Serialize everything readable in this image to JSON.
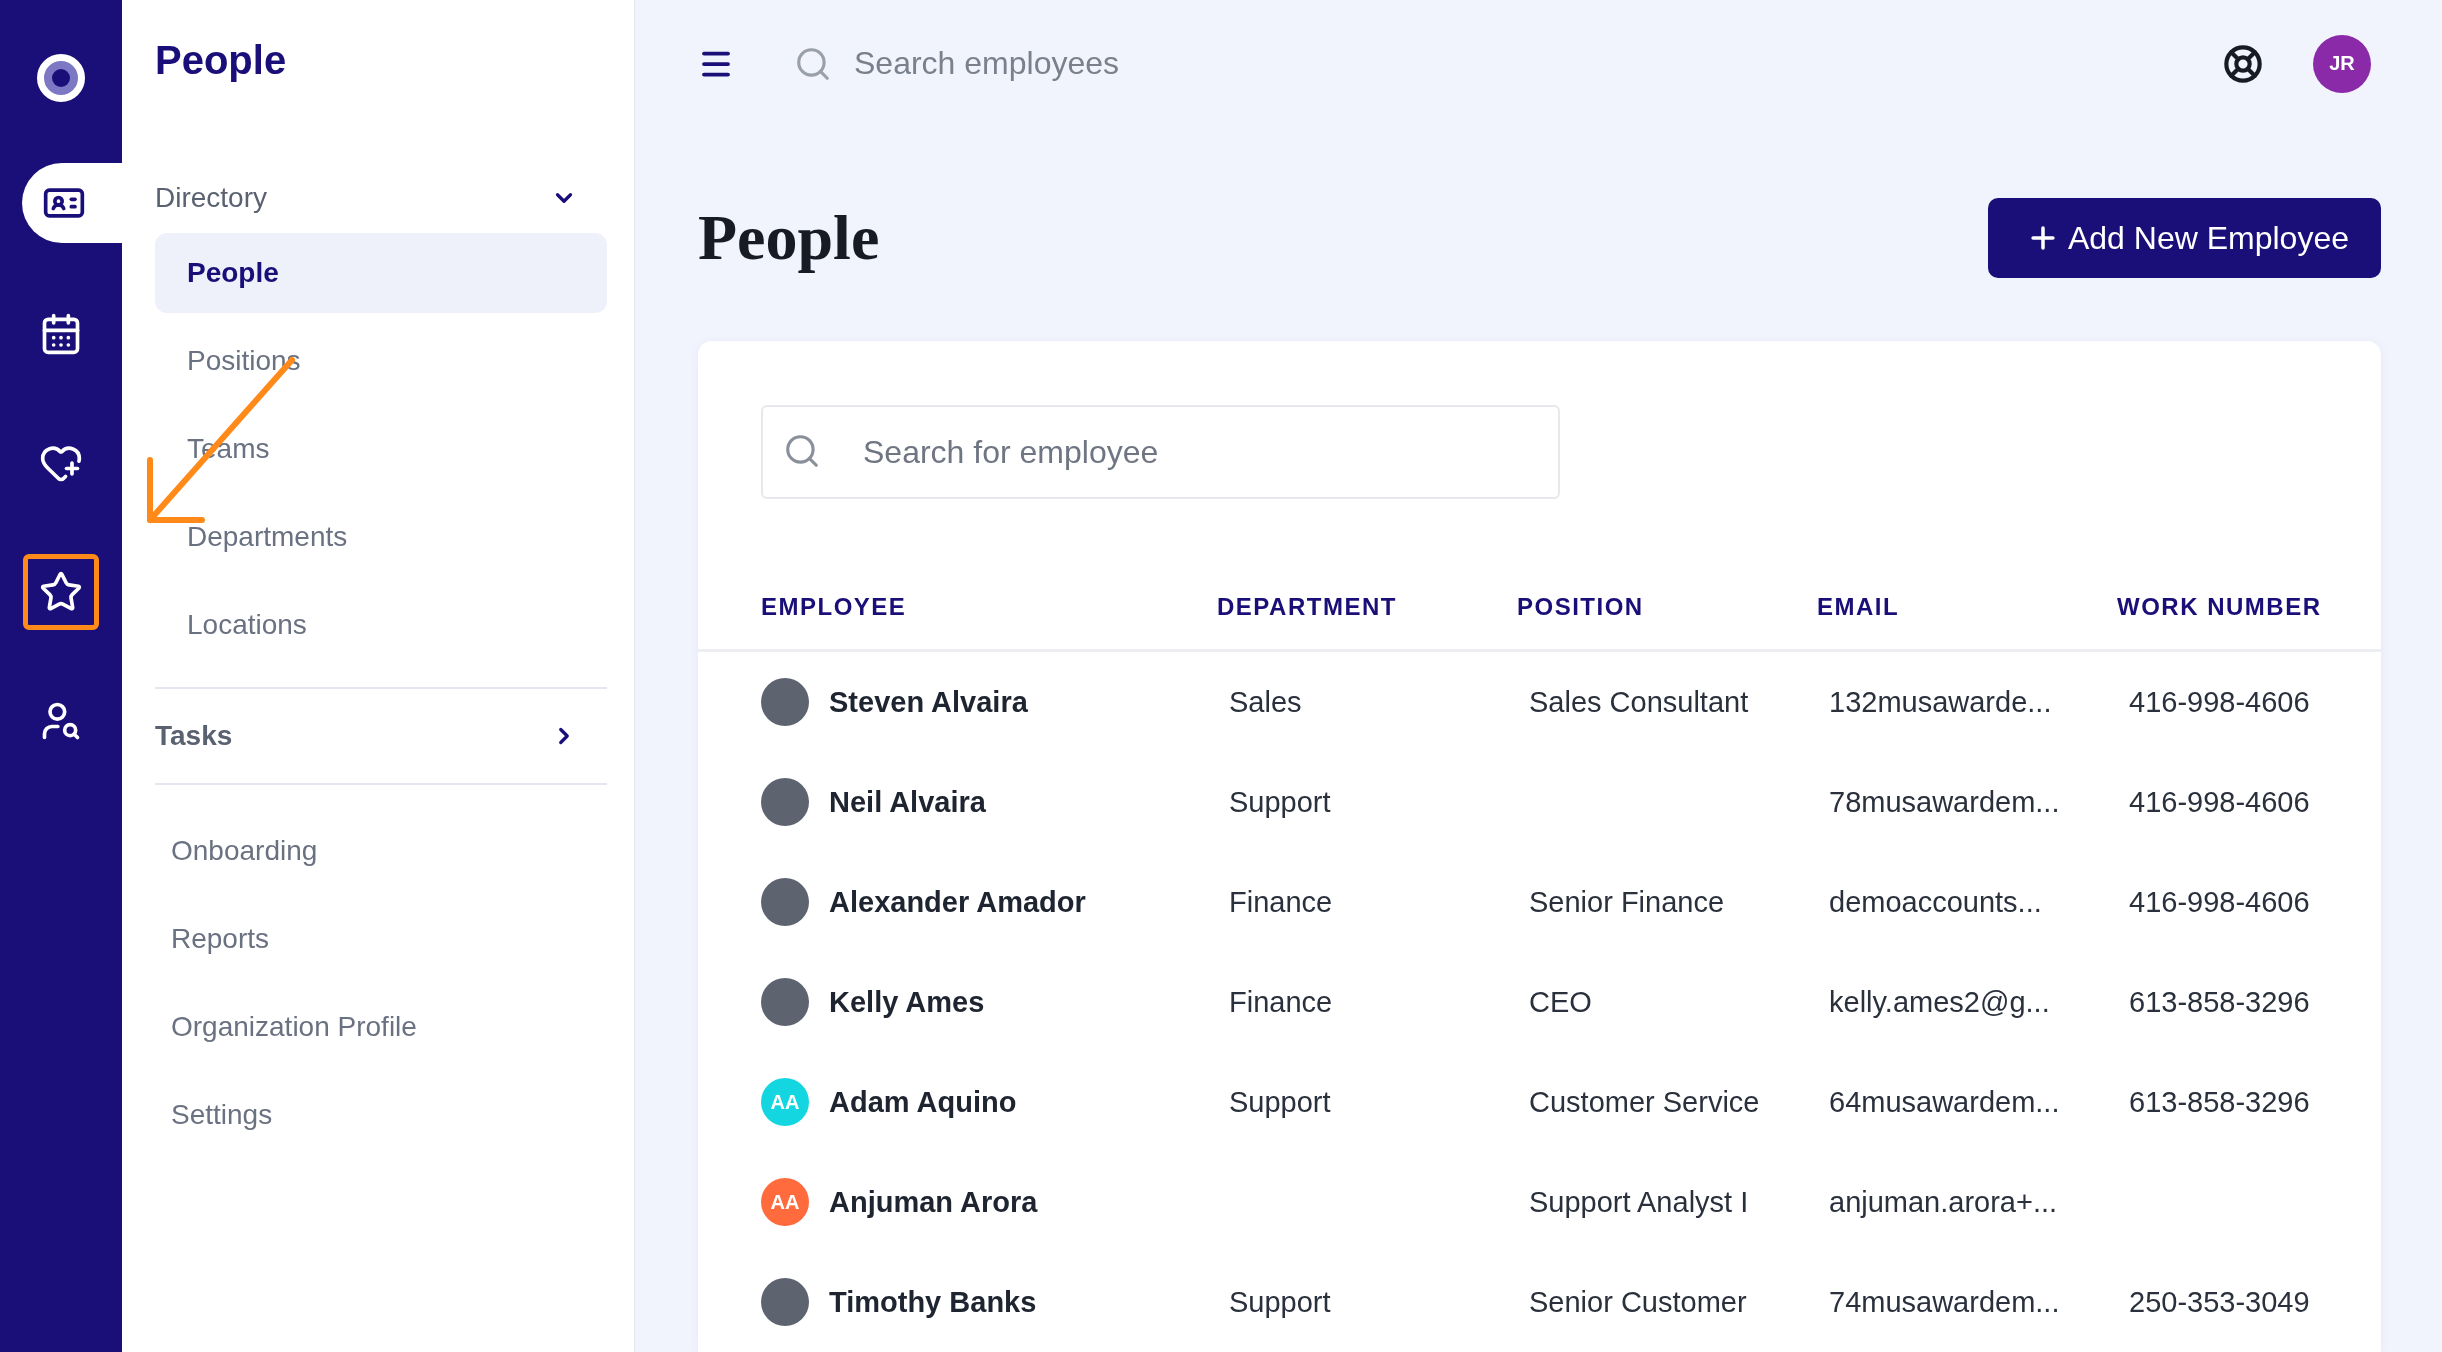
{
  "rail": {
    "items": [
      {
        "selected": true,
        "highlighted": false
      },
      {
        "selected": false,
        "highlighted": false
      },
      {
        "selected": false,
        "highlighted": false
      },
      {
        "selected": false,
        "highlighted": true
      },
      {
        "selected": false,
        "highlighted": false
      }
    ]
  },
  "sidebar": {
    "title": "People",
    "sections": [
      {
        "kind": "group",
        "label": "Directory",
        "expanded": true,
        "items": [
          {
            "label": "People",
            "selected": true
          },
          {
            "label": "Positions",
            "selected": false
          },
          {
            "label": "Teams",
            "selected": false
          },
          {
            "label": "Departments",
            "selected": false
          },
          {
            "label": "Locations",
            "selected": false
          }
        ]
      },
      {
        "kind": "group",
        "label": "Tasks",
        "expanded": false
      },
      {
        "kind": "links",
        "items": [
          {
            "label": "Onboarding",
            "selected": false
          },
          {
            "label": "Reports",
            "selected": false
          },
          {
            "label": "Organization Profile",
            "selected": false
          },
          {
            "label": "Settings",
            "selected": false
          }
        ]
      }
    ]
  },
  "header": {
    "search": {
      "placeholder": "Search employees"
    },
    "user": {
      "initials": "JR"
    }
  },
  "page": {
    "title": "People",
    "add_button": "Add New Employee"
  },
  "table": {
    "search": {
      "placeholder": "Search for employee"
    },
    "columns": [
      "EMPLOYEE",
      "DEPARTMENT",
      "POSITION",
      "EMAIL",
      "WORK NUMBER"
    ],
    "rows": [
      {
        "avatar": {
          "kind": "photo"
        },
        "name": "Steven Alvaira",
        "department": "Sales",
        "position": "Sales Consultant",
        "email": "132musawarde...",
        "work_number": "416-998-4606"
      },
      {
        "avatar": {
          "kind": "photo"
        },
        "name": "Neil Alvaira",
        "department": "Support",
        "position": "",
        "email": "78musawardem...",
        "work_number": "416-998-4606"
      },
      {
        "avatar": {
          "kind": "photo"
        },
        "name": "Alexander Amador",
        "department": "Finance",
        "position": "Senior Finance",
        "email": "demoaccounts...",
        "work_number": "416-998-4606"
      },
      {
        "avatar": {
          "kind": "photo"
        },
        "name": "Kelly Ames",
        "department": "Finance",
        "position": "CEO",
        "email": "kelly.ames2@g...",
        "work_number": "613-858-3296"
      },
      {
        "avatar": {
          "kind": "initials",
          "initials": "AA",
          "color": "#14d6e0"
        },
        "name": "Adam Aquino",
        "department": "Support",
        "position": "Customer Service",
        "email": "64musawardem...",
        "work_number": "613-858-3296"
      },
      {
        "avatar": {
          "kind": "initials",
          "initials": "AA",
          "color": "#ff6b3d"
        },
        "name": "Anjuman Arora",
        "department": "",
        "position": "Support Analyst I",
        "email": "anjuman.arora+...",
        "work_number": ""
      },
      {
        "avatar": {
          "kind": "photo"
        },
        "name": "Timothy Banks",
        "department": "Support",
        "position": "Senior Customer",
        "email": "74musawardem...",
        "work_number": "250-353-3049"
      }
    ]
  }
}
